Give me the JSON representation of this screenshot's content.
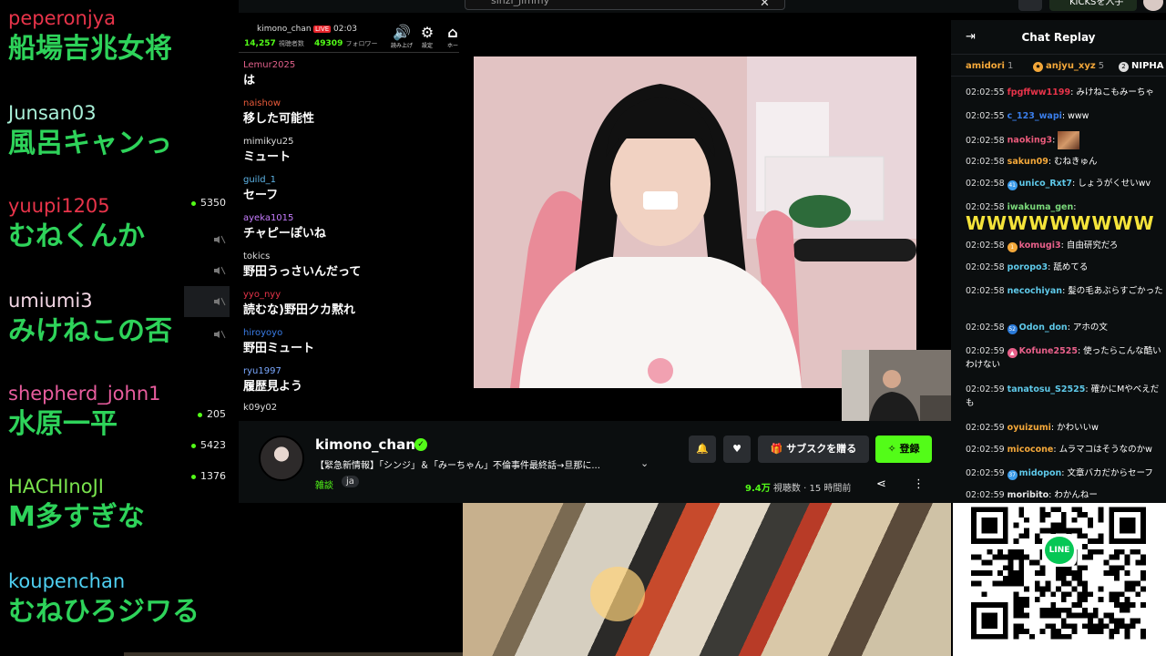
{
  "big_comments": [
    {
      "user": "peperonjya",
      "user_color": "#e8344a",
      "message": "船場吉兆女将"
    },
    {
      "user": "Junsan03",
      "user_color": "#a9f0d8",
      "message": "風呂キャンっ"
    },
    {
      "user": "yuupi1205",
      "user_color": "#e8344a",
      "message": "むねくんか"
    },
    {
      "user": "umiumi3",
      "user_color": "#f2d6e4",
      "message": "みけねこの否"
    },
    {
      "user": "shepherd_john1",
      "user_color": "#e85d9e",
      "message": "水原一平"
    },
    {
      "user": "HACHInoJI",
      "user_color": "#79e34d",
      "message": "M多すぎな"
    },
    {
      "user": "koupenchan",
      "user_color": "#4fd0f2",
      "message": "むねひろジワる"
    }
  ],
  "viewer_counts": [
    "5350",
    "205",
    "5423",
    "1376"
  ],
  "top": {
    "search_value": "sinzi_jimmy",
    "kicks_label": "KICKSを入手"
  },
  "mini_chat": {
    "channel": "kimono_chan",
    "live": "LIVE",
    "time": "02:03",
    "followers_a": "14,257",
    "followers_a_label": "視聴者数",
    "followers_b": "49309",
    "followers_b_label": "フォロワー",
    "icons": [
      {
        "name": "read-aloud-icon",
        "glyph": "🔊",
        "label": "読み上げ"
      },
      {
        "name": "settings-icon",
        "glyph": "⚙",
        "label": "設定"
      },
      {
        "name": "home-icon",
        "glyph": "⌂",
        "label": "ホー"
      }
    ],
    "messages": [
      {
        "user": "Lemur2025",
        "color": "#e0608a",
        "text": "は"
      },
      {
        "user": "naishow",
        "color": "#e85a3a",
        "text": "移した可能性"
      },
      {
        "user": "mimikyu25",
        "color": "#dddddd",
        "text": "ミュート"
      },
      {
        "user": "guild_1",
        "color": "#5eb5e8",
        "text": "セーフ"
      },
      {
        "user": "ayeka1015",
        "color": "#c77dff",
        "text": "チャピーぽいね"
      },
      {
        "user": "tokics",
        "color": "#dddddd",
        "text": "野田うっさいんだって"
      },
      {
        "user": "yyo_nyy",
        "color": "#e8344a",
        "text": "読むな)野田クカ黙れ"
      },
      {
        "user": "hiroyoyo",
        "color": "#3a7de8",
        "text": "野田ミュート"
      },
      {
        "user": "ryu1997",
        "color": "#7aa8ff",
        "text": "履歴見よう"
      },
      {
        "user": "k09y02",
        "color": "#dddddd",
        "text": ""
      }
    ]
  },
  "stream": {
    "channel": "kimono_chan",
    "title": "【緊急新情報】「シンジ」＆「みーちゃん」不倫事件最終話→旦那に...",
    "category": "雑談",
    "language": "ja",
    "sub_label": "サブスクを贈る",
    "follow_label": "登録",
    "views_count": "9.4万",
    "views_label": "視聴数",
    "ago": "15 時間前"
  },
  "chat_replay": {
    "title": "Chat Replay",
    "gifters": [
      {
        "name": "amidori",
        "count": "1"
      },
      {
        "name": "anjyu_xyz",
        "count": "5"
      },
      {
        "name": "NIPHA",
        "count": ""
      }
    ],
    "messages": [
      {
        "ts": "02:02:55",
        "user": "fpgffww1199",
        "color": "#e8344a",
        "badge": "",
        "text": "みけねこもみーちゃ"
      },
      {
        "ts": "02:02:55",
        "user": "c_123_wapi",
        "color": "#3a7de8",
        "badge": "",
        "text": "www"
      },
      {
        "ts": "02:02:58",
        "user": "naoking3",
        "color": "#e85a7a",
        "badge": "",
        "text": "",
        "emote": true
      },
      {
        "ts": "02:02:58",
        "user": "sakun09",
        "color": "#f4a83a",
        "badge": "",
        "text": "むねきゅん"
      },
      {
        "ts": "02:02:58",
        "user": "unico_Rxt7",
        "color": "#5ec8e8",
        "badge": "41",
        "text": "しょうがくせいwv"
      },
      {
        "ts": "02:02:58",
        "user": "iwakuma_gen",
        "color": "#7ad87a",
        "badge": "",
        "text": "WWWWWWWWW",
        "big": true
      },
      {
        "ts": "02:02:58",
        "user": "komugi3",
        "color": "#e8608a",
        "badge": "1",
        "text": "自由研究だろ"
      },
      {
        "ts": "02:02:58",
        "user": "poropo3",
        "color": "#5ec8e8",
        "badge": "",
        "text": "舐めてる"
      },
      {
        "ts": "02:02:58",
        "user": "necochiyan",
        "color": "#5ec8e8",
        "badge": "",
        "text": "髪の毛あぶらすごかった"
      },
      {
        "ts": "02:02:58",
        "user": "Odon_don",
        "color": "#5ec8e8",
        "badge": "52",
        "text": "アホの文"
      },
      {
        "ts": "02:02:59",
        "user": "Kofune2525",
        "color": "#e8608a",
        "badge": "▲",
        "text": "使ったらこんな酷いわけない"
      },
      {
        "ts": "02:02:59",
        "user": "tanatosu_S2525",
        "color": "#5ec8e8",
        "badge": "",
        "text": "確かにMやべえだも"
      },
      {
        "ts": "02:02:59",
        "user": "oyuizumi",
        "color": "#f4a83a",
        "badge": "",
        "text": "かわいいw"
      },
      {
        "ts": "02:02:59",
        "user": "micocone",
        "color": "#f4a83a",
        "badge": "",
        "text": "ムラマコはそうなのかw"
      },
      {
        "ts": "02:02:59",
        "user": "midopon",
        "color": "#5ec8e8",
        "badge": "37",
        "text": "文章バカだからセーフ"
      },
      {
        "ts": "02:02:59",
        "user": "moribito",
        "color": "#e8e8e8",
        "badge": "",
        "text": "わかんねー"
      }
    ]
  },
  "qr": {
    "logo_text": "LINE"
  }
}
